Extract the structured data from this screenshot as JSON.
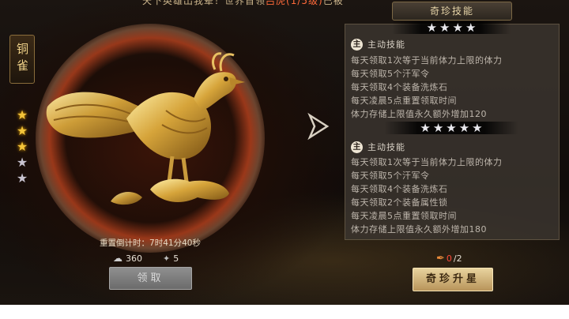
{
  "banner": {
    "text_a": "天下英雄出我辈！世界首领",
    "text_hl": "吕虎(1/5级)",
    "text_b": "已被"
  },
  "treasure": {
    "name": "铜雀",
    "stars_total": 5,
    "stars_lit": 3
  },
  "timer": {
    "text": "重置倒计时：7时41分40秒"
  },
  "resources": [
    {
      "icon": "silver-icon",
      "value": "360"
    },
    {
      "icon": "scroll-icon",
      "value": "5"
    }
  ],
  "claim_button": {
    "label": "领取"
  },
  "panel": {
    "title": "奇珍技能",
    "tier1": {
      "stars": 4,
      "badge": "主",
      "label": "主动技能",
      "lines": [
        "每天领取1次等于当前体力上限的体力",
        "每天领取5个汗军令",
        "每天领取4个装备洗炼石",
        "每天凌晨5点重置领取时间",
        "体力存储上限值永久额外增加120"
      ]
    },
    "tier2": {
      "stars": 5,
      "badge": "主",
      "label": "主动技能",
      "lines": [
        "每天领取1次等于当前体力上限的体力",
        "每天领取5个汗军令",
        "每天领取4个装备洗炼石",
        "每天领取2个装备属性锁",
        "每天凌晨5点重置领取时间",
        "体力存储上限值永久额外增加180"
      ]
    }
  },
  "material": {
    "current": "0",
    "required": "/2"
  },
  "upgrade_button": {
    "label": "奇珍升星"
  },
  "colors": {
    "gold": "#f3c43a",
    "accent_red": "#ff4a3a",
    "panel_text": "#bdb5ab"
  }
}
